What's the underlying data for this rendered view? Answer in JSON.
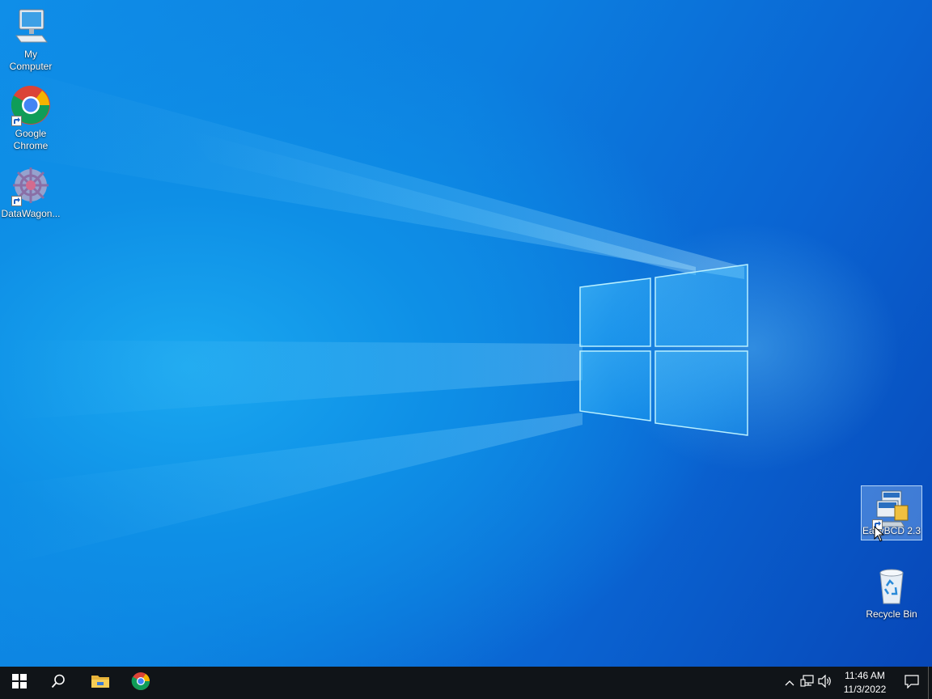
{
  "desktop": {
    "icons": [
      {
        "id": "my-computer",
        "label": "My\nComputer",
        "icon": "computer-icon",
        "shortcut": false
      },
      {
        "id": "google-chrome",
        "label": "Google\nChrome",
        "icon": "chrome-icon",
        "shortcut": true
      },
      {
        "id": "datawagon",
        "label": "DataWagon...",
        "icon": "datawagon-icon",
        "shortcut": true
      },
      {
        "id": "easybcd",
        "label": "EasyBCD 2.3",
        "icon": "easybcd-icon",
        "shortcut": true,
        "selected": true
      },
      {
        "id": "recycle-bin",
        "label": "Recycle Bin",
        "icon": "recycle-bin-icon",
        "shortcut": false
      }
    ]
  },
  "taskbar": {
    "start": {
      "icon": "windows-start-icon"
    },
    "search": {
      "icon": "search-icon"
    },
    "pinned": [
      {
        "name": "File Explorer",
        "icon": "folder-icon"
      },
      {
        "name": "Google Chrome",
        "icon": "chrome-icon"
      }
    ],
    "tray": {
      "overflow_icon": "chevron-up-icon",
      "network_icon": "network-icon",
      "volume_icon": "speaker-icon",
      "time": "11:46 AM",
      "date": "11/3/2022",
      "notifications_icon": "action-center-icon"
    }
  },
  "colors": {
    "taskbar": "#101418",
    "wallpaper_primary": "#0c7fe0",
    "wallpaper_deep": "#0747b8",
    "selection": "#aad2ff"
  }
}
